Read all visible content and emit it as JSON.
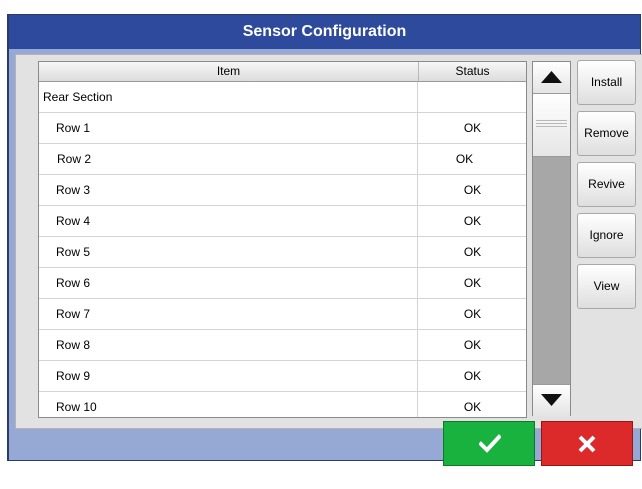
{
  "dialog": {
    "title": "Sensor Configuration"
  },
  "table": {
    "columns": {
      "item": "Item",
      "status": "Status"
    },
    "rows": [
      {
        "item": "Rear Section",
        "status": ""
      },
      {
        "item": "Row 1",
        "status": "OK"
      },
      {
        "item": "Row 2",
        "status": "OK"
      },
      {
        "item": "Row 3",
        "status": "OK"
      },
      {
        "item": "Row 4",
        "status": "OK"
      },
      {
        "item": "Row 5",
        "status": "OK"
      },
      {
        "item": "Row 6",
        "status": "OK"
      },
      {
        "item": "Row 7",
        "status": "OK"
      },
      {
        "item": "Row 8",
        "status": "OK"
      },
      {
        "item": "Row 9",
        "status": "OK"
      },
      {
        "item": "Row 10",
        "status": "OK"
      }
    ]
  },
  "actions": {
    "install": "Install",
    "remove": "Remove",
    "revive": "Revive",
    "ignore": "Ignore",
    "view": "View"
  },
  "footer": {
    "ok_icon": "checkmark-icon",
    "cancel_icon": "close-icon"
  },
  "colors": {
    "titlebar": "#2d4a9c",
    "dialog_bg": "#96a8d4",
    "ok": "#19b23e",
    "cancel": "#dc2a2a"
  }
}
